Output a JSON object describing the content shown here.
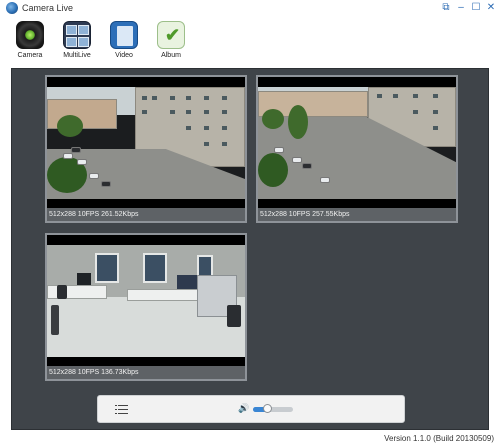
{
  "window": {
    "title": "Camera Live",
    "controls": {
      "restore": "⧉",
      "minimize": "–",
      "maximize": "☐",
      "close": "✕"
    }
  },
  "toolbar": {
    "items": [
      {
        "label": "Camera",
        "icon": "camera-lens-icon"
      },
      {
        "label": "MultiLive",
        "icon": "multi-view-icon"
      },
      {
        "label": "Video",
        "icon": "film-icon"
      },
      {
        "label": "Album",
        "icon": "album-check-icon"
      }
    ]
  },
  "streams": [
    {
      "status": "512x288  10FPS 261.52Kbps",
      "scene": "outdoor-courtyard"
    },
    {
      "status": "512x288  10FPS 257.55Kbps",
      "scene": "outdoor-courtyard-wide"
    },
    {
      "status": "512x288  10FPS 136.73Kbps",
      "scene": "indoor-office"
    }
  ],
  "controls": {
    "list_icon": "list-icon",
    "volume_icon": "🔊",
    "volume_level": 0.35
  },
  "footer": {
    "version": "Version 1.1.0 (Build 20130509)"
  },
  "colors": {
    "accent": "#3a86d4",
    "background": "#3f4449",
    "status_bar": "#5e6266"
  }
}
